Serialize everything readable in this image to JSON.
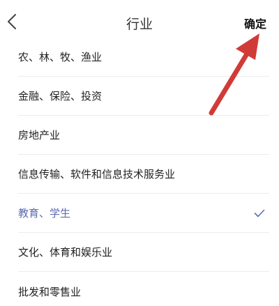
{
  "header": {
    "title": "行业",
    "confirm_label": "确定"
  },
  "industries": [
    {
      "label": "农、林、牧、渔业",
      "selected": false
    },
    {
      "label": "金融、保险、投资",
      "selected": false
    },
    {
      "label": "房地产业",
      "selected": false
    },
    {
      "label": "信息传输、软件和信息技术服务业",
      "selected": false
    },
    {
      "label": "教育、学生",
      "selected": true
    },
    {
      "label": "文化、体育和娱乐业",
      "selected": false
    },
    {
      "label": "批发和零售业",
      "selected": false
    }
  ],
  "colors": {
    "selected_accent": "#5b6bb0",
    "annotation_arrow": "#d13b37"
  },
  "icons": {
    "back": "chevron-left-icon",
    "selected": "checkmark-icon",
    "annotation": "red-arrow-annotation"
  }
}
